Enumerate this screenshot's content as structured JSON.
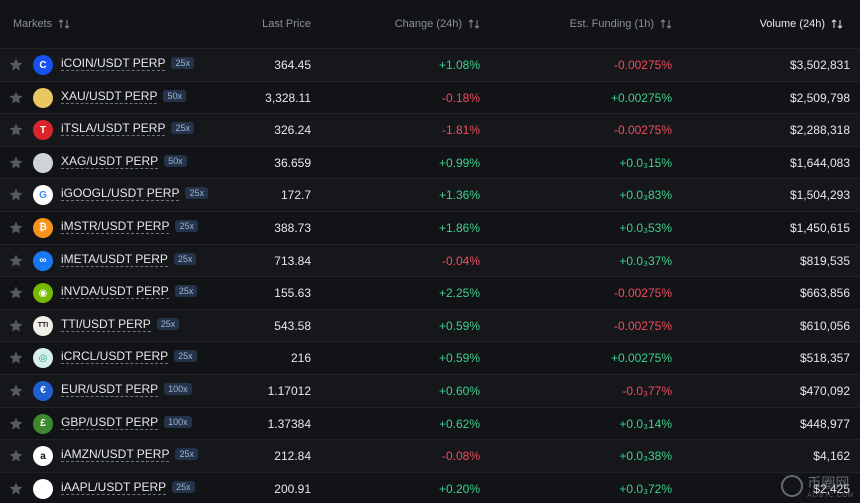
{
  "header": {
    "markets": "Markets",
    "last_price": "Last Price",
    "change": "Change (24h)",
    "funding": "Est. Funding (1h)",
    "volume": "Volume (24h)"
  },
  "rows": [
    {
      "pair": "iCOIN/USDT PERP",
      "lev": "25x",
      "price": "364.45",
      "change": "+1.08%",
      "change_dir": "pos",
      "funding": "-0.00275%",
      "funding_dir": "neg",
      "volume": "$3,502,831",
      "logo": "coinbase",
      "logo_color": "#1652f0",
      "logo_text": "C"
    },
    {
      "pair": "XAU/USDT PERP",
      "lev": "50x",
      "price": "3,328.11",
      "change": "-0.18%",
      "change_dir": "neg",
      "funding": "+0.00275%",
      "funding_dir": "pos",
      "volume": "$2,509,798",
      "logo": "gold",
      "logo_color": "#e8c760",
      "logo_text": ""
    },
    {
      "pair": "iTSLA/USDT PERP",
      "lev": "25x",
      "price": "326.24",
      "change": "-1.81%",
      "change_dir": "neg",
      "funding": "-0.00275%",
      "funding_dir": "neg",
      "volume": "$2,288,318",
      "logo": "tesla",
      "logo_color": "#d9262c",
      "logo_text": "T"
    },
    {
      "pair": "XAG/USDT PERP",
      "lev": "50x",
      "price": "36.659",
      "change": "+0.99%",
      "change_dir": "pos",
      "funding": "+0.0₃15%",
      "funding_dir": "pos",
      "volume": "$1,644,083",
      "logo": "silver",
      "logo_color": "#cfd2d6",
      "logo_text": ""
    },
    {
      "pair": "iGOOGL/USDT PERP",
      "lev": "25x",
      "price": "172.7",
      "change": "+1.36%",
      "change_dir": "pos",
      "funding": "+0.0₃83%",
      "funding_dir": "pos",
      "volume": "$1,504,293",
      "logo": "google",
      "logo_color": "#ffffff",
      "logo_text": "G"
    },
    {
      "pair": "iMSTR/USDT PERP",
      "lev": "25x",
      "price": "388.73",
      "change": "+1.86%",
      "change_dir": "pos",
      "funding": "+0.0₃53%",
      "funding_dir": "pos",
      "volume": "$1,450,615",
      "logo": "bitcoin",
      "logo_color": "#f7931a",
      "logo_text": "₿"
    },
    {
      "pair": "iMETA/USDT PERP",
      "lev": "25x",
      "price": "713.84",
      "change": "-0.04%",
      "change_dir": "neg",
      "funding": "+0.0₃37%",
      "funding_dir": "pos",
      "volume": "$819,535",
      "logo": "meta",
      "logo_color": "#1877f2",
      "logo_text": "∞"
    },
    {
      "pair": "iNVDA/USDT PERP",
      "lev": "25x",
      "price": "155.63",
      "change": "+2.25%",
      "change_dir": "pos",
      "funding": "-0.00275%",
      "funding_dir": "neg",
      "volume": "$663,856",
      "logo": "nvidia",
      "logo_color": "#76b900",
      "logo_text": "◉"
    },
    {
      "pair": "TTI/USDT PERP",
      "lev": "25x",
      "price": "543.58",
      "change": "+0.59%",
      "change_dir": "pos",
      "funding": "-0.00275%",
      "funding_dir": "neg",
      "volume": "$610,056",
      "logo": "tti",
      "logo_color": "#f2efe6",
      "logo_text": "TTI"
    },
    {
      "pair": "iCRCL/USDT PERP",
      "lev": "25x",
      "price": "216",
      "change": "+0.59%",
      "change_dir": "pos",
      "funding": "+0.00275%",
      "funding_dir": "pos",
      "volume": "$518,357",
      "logo": "circle",
      "logo_color": "#d8f0ea",
      "logo_text": "◎"
    },
    {
      "pair": "EUR/USDT PERP",
      "lev": "100x",
      "price": "1.17012",
      "change": "+0.60%",
      "change_dir": "pos",
      "funding": "-0.0₃77%",
      "funding_dir": "neg",
      "volume": "$470,092",
      "logo": "euro",
      "logo_color": "#1f5fd0",
      "logo_text": "€"
    },
    {
      "pair": "GBP/USDT PERP",
      "lev": "100x",
      "price": "1.37384",
      "change": "+0.62%",
      "change_dir": "pos",
      "funding": "+0.0₃14%",
      "funding_dir": "pos",
      "volume": "$448,977",
      "logo": "pound",
      "logo_color": "#3f8a2e",
      "logo_text": "£"
    },
    {
      "pair": "iAMZN/USDT PERP",
      "lev": "25x",
      "price": "212.84",
      "change": "-0.08%",
      "change_dir": "neg",
      "funding": "+0.0₃38%",
      "funding_dir": "pos",
      "volume": "$4,162",
      "logo": "amazon",
      "logo_color": "#ffffff",
      "logo_text": "a"
    },
    {
      "pair": "iAAPL/USDT PERP",
      "lev": "25x",
      "price": "200.91",
      "change": "+0.20%",
      "change_dir": "pos",
      "funding": "+0.0₃72%",
      "funding_dir": "pos",
      "volume": "$2,425",
      "logo": "apple",
      "logo_color": "#ffffff",
      "logo_text": ""
    }
  ],
  "watermark": {
    "text": "币圈网",
    "sub": "ALIBTC.COM"
  }
}
